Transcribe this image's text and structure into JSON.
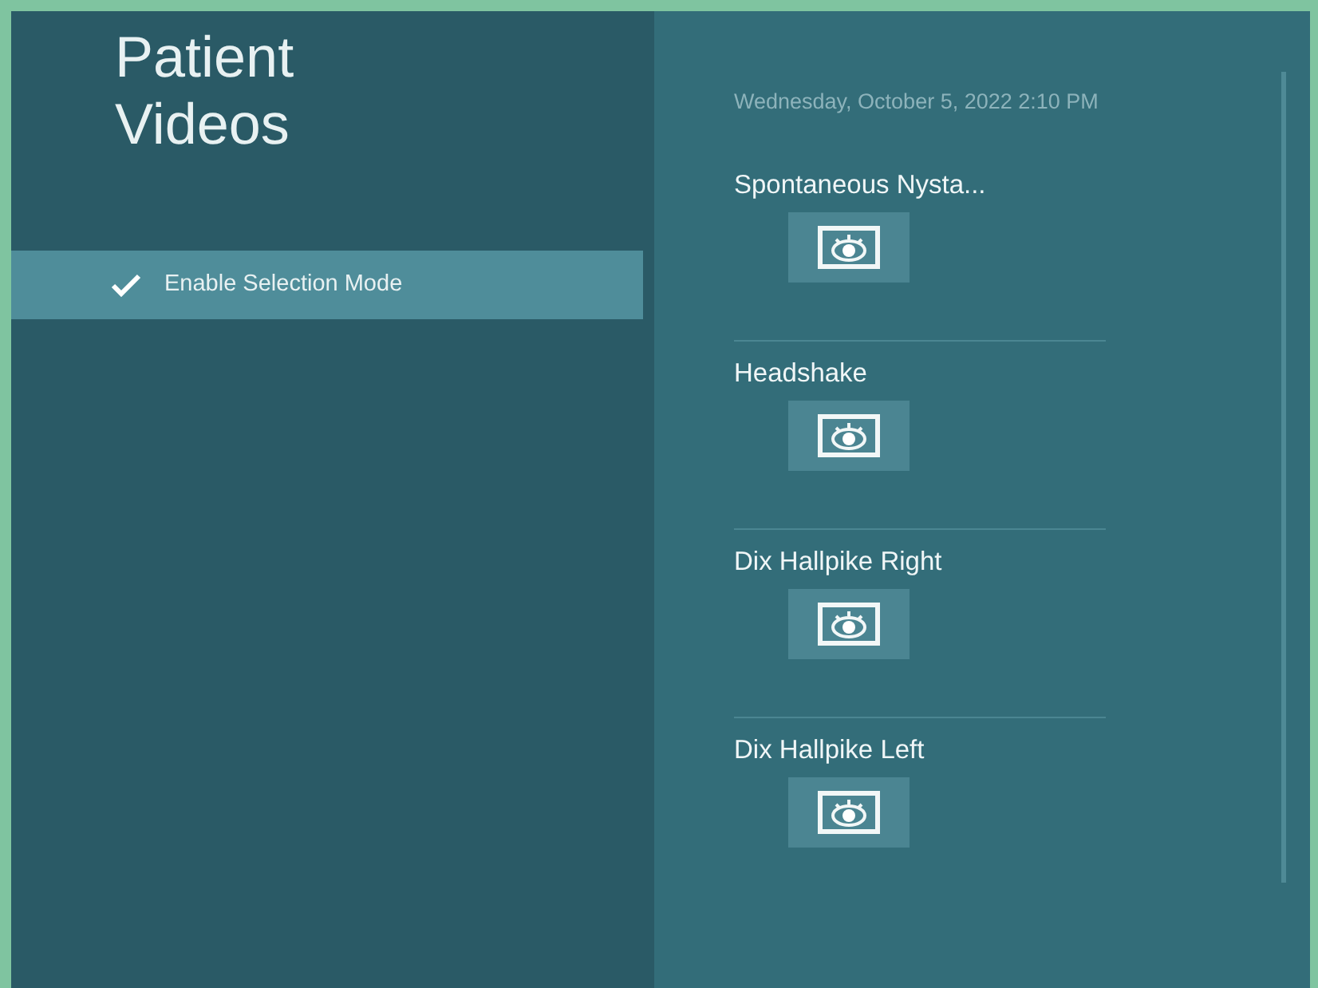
{
  "title_lines": [
    "Patient",
    "Videos"
  ],
  "menu": [
    {
      "label": "Enable Selection Mode",
      "checked": true,
      "selected": true
    }
  ],
  "session": {
    "date": "Wednesday, October 5, 2022 2:10 PM",
    "videos": [
      {
        "label": "Spontaneous Nysta..."
      },
      {
        "label": "Headshake"
      },
      {
        "label": "Dix Hallpike Right"
      },
      {
        "label": "Dix Hallpike Left"
      }
    ]
  }
}
